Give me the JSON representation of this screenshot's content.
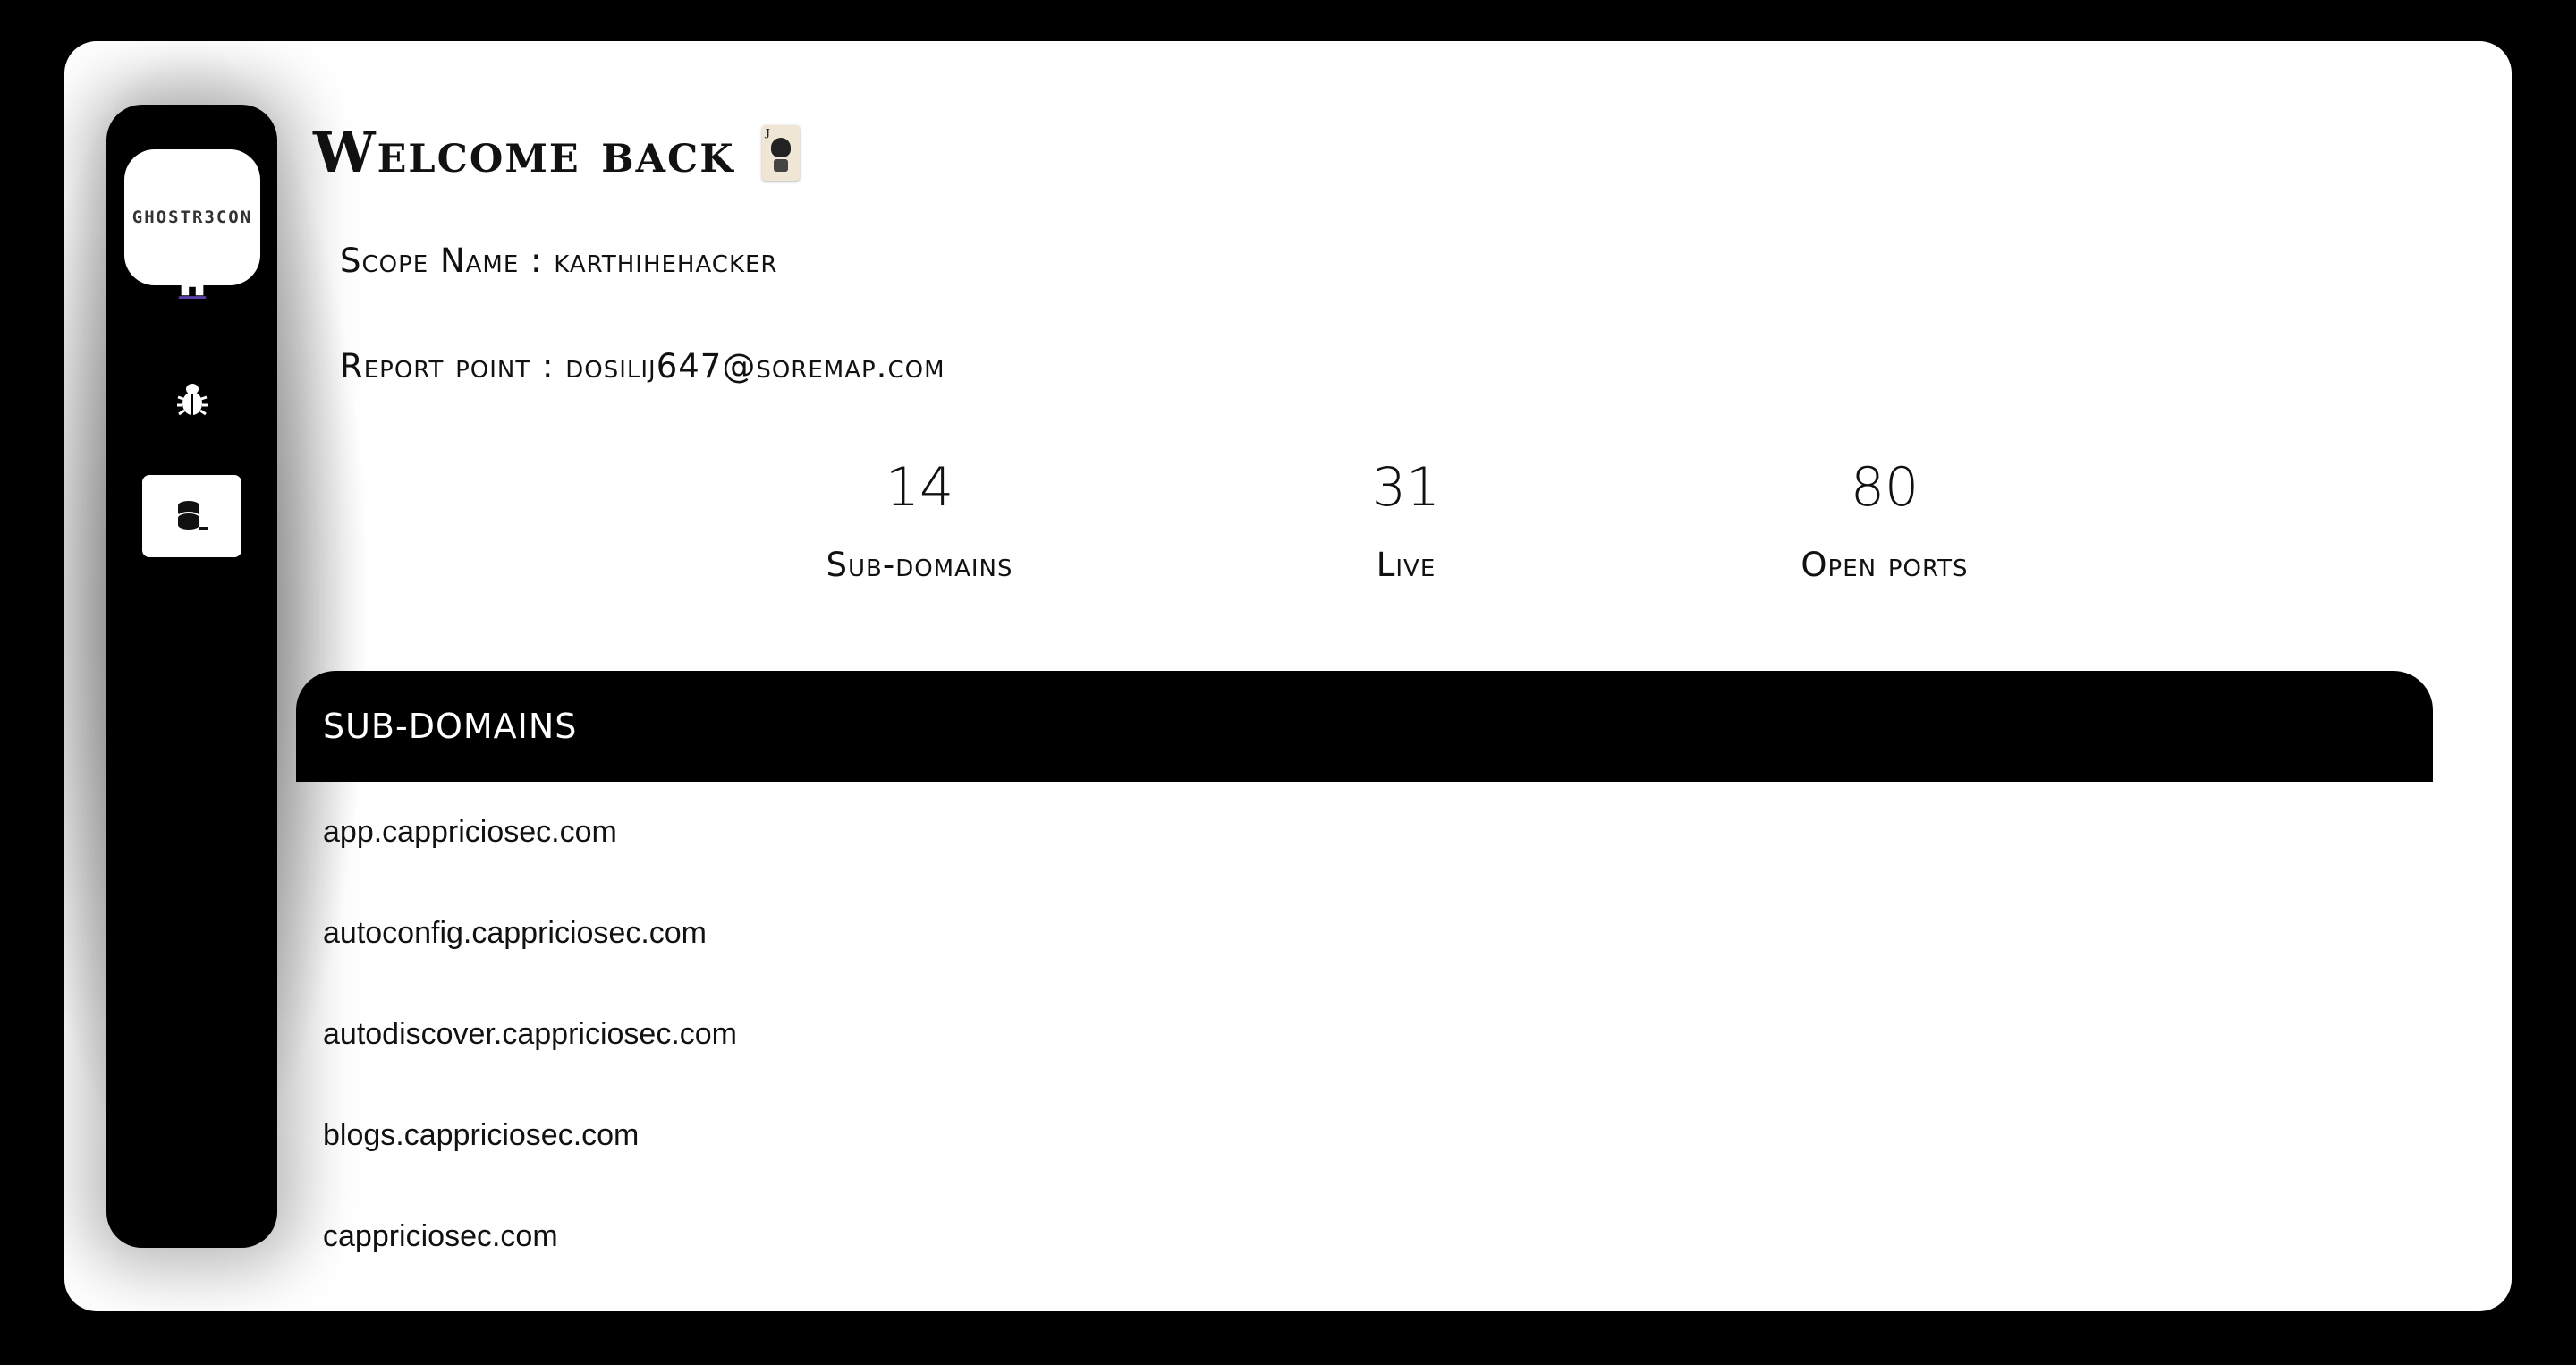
{
  "sidebar": {
    "logo_text": "GHOSTR3CON",
    "items": [
      {
        "icon": "home-icon"
      },
      {
        "icon": "bug-icon"
      },
      {
        "icon": "database-icon",
        "active": true
      }
    ]
  },
  "header": {
    "welcome": "Welcome back"
  },
  "scope": {
    "name_line": "Scope Name : karthihehacker",
    "report_line": "Report point : dosilij647@soremap.com"
  },
  "stats": [
    {
      "value": "14",
      "label": "Sub-domains"
    },
    {
      "value": "31",
      "label": "Live"
    },
    {
      "value": "80",
      "label": "Open ports"
    }
  ],
  "table": {
    "title": "SUB-DOMAINS",
    "rows": [
      "app.cappriciosec.com",
      "autoconfig.cappriciosec.com",
      "autodiscover.cappriciosec.com",
      "blogs.cappriciosec.com",
      "cappriciosec.com"
    ]
  },
  "colors": {
    "background": "#000000",
    "panel": "#ffffff",
    "sidebar": "#000000"
  }
}
